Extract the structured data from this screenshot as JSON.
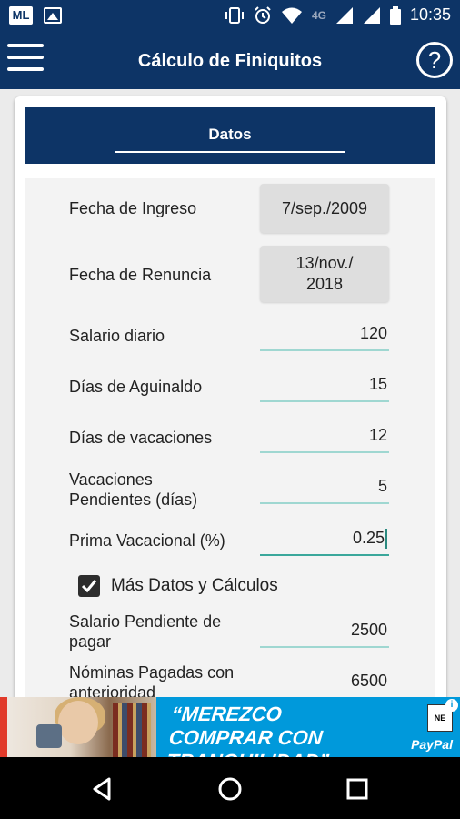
{
  "status_bar": {
    "app_badge": "ML",
    "network": "4G",
    "time": "10:35"
  },
  "app_bar": {
    "title": "Cálculo de Finiquitos",
    "help_label": "?"
  },
  "section": {
    "tab_label": "Datos"
  },
  "form": {
    "fecha_ingreso": {
      "label": "Fecha de Ingreso",
      "value": "7/sep./2009"
    },
    "fecha_renuncia": {
      "label": "Fecha de Renuncia",
      "value_line1": "13/nov./",
      "value_line2": "2018"
    },
    "salario_diario": {
      "label": "Salario diario",
      "value": "120"
    },
    "dias_aguinaldo": {
      "label": "Días de Aguinaldo",
      "value": "15"
    },
    "dias_vacaciones": {
      "label": "Días de vacaciones",
      "value": "12"
    },
    "vacaciones_pendientes": {
      "label_line1": "Vacaciones",
      "label_line2": "Pendientes (días)",
      "value": "5"
    },
    "prima_vacacional": {
      "label": "Prima Vacacional (%)",
      "value": "0.25"
    },
    "mas_datos": {
      "label": "Más Datos y Cálculos",
      "checked": true
    },
    "salario_pendiente": {
      "label_line1": "Salario Pendiente de",
      "label_line2": "pagar",
      "value": "2500"
    },
    "nominas_pagadas": {
      "label_line1": "Nóminas Pagadas con",
      "label_line2": "anterioridad",
      "value": "6500"
    }
  },
  "ad": {
    "headline_line1": "“MEREZCO COMPRAR CON",
    "headline_line2": "TRANQUILIDAD”",
    "brand": "PayPal",
    "logo_text": "NE",
    "info_icon": "i"
  },
  "colors": {
    "primary": "#0d3466",
    "field_underline": "#9fd7d1",
    "field_active": "#3aa79b",
    "ad_background": "#0099db"
  }
}
